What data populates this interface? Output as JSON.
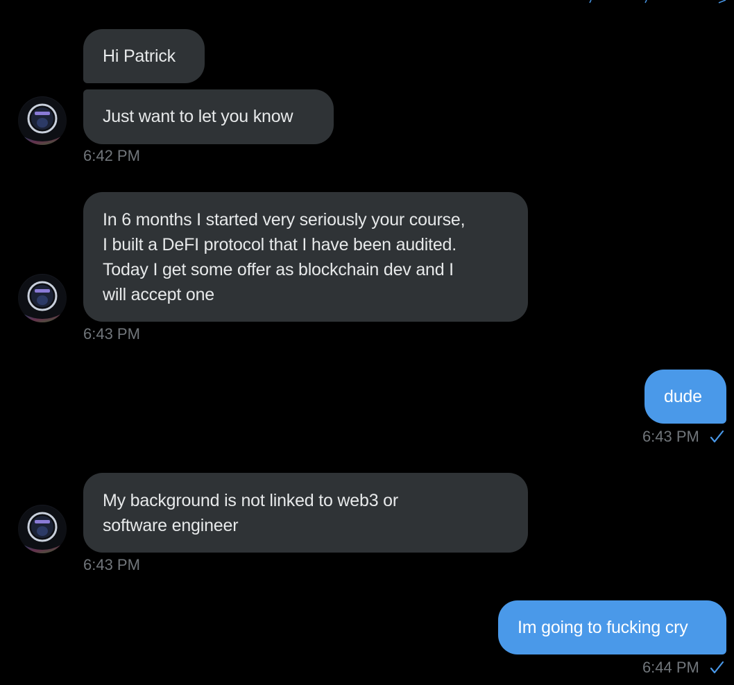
{
  "conversation": {
    "groups": [
      {
        "direction": "incoming",
        "messages": [
          {
            "text_lines": [
              "Hi Patrick"
            ]
          },
          {
            "text_lines": [
              "Just want to let you know"
            ]
          }
        ],
        "timestamp": "6:42 PM"
      },
      {
        "direction": "incoming",
        "messages": [
          {
            "text_lines": [
              "In 6 months I started very seriously your course,",
              "I built a DeFI protocol that I have been audited.",
              "Today I get some offer as blockchain dev and I",
              "will accept one"
            ]
          }
        ],
        "timestamp": "6:43 PM"
      },
      {
        "direction": "outgoing",
        "messages": [
          {
            "text_lines": [
              "dude"
            ]
          }
        ],
        "timestamp": "6:43 PM",
        "status_icon": "sent-check-icon"
      },
      {
        "direction": "incoming",
        "messages": [
          {
            "text_lines": [
              "My background is not linked to web3 or",
              "software engineer"
            ]
          }
        ],
        "timestamp": "6:43 PM"
      },
      {
        "direction": "outgoing",
        "messages": [
          {
            "text_lines": [
              "Im going to fucking cry"
            ]
          }
        ],
        "timestamp": "6:44 PM",
        "status_icon": "sent-check-icon"
      }
    ]
  },
  "colors": {
    "background": "#000000",
    "incoming_bubble": "#2f3336",
    "outgoing_bubble": "#4a99e9",
    "timestamp_text": "#71767b",
    "check_icon": "#4a99e9"
  }
}
